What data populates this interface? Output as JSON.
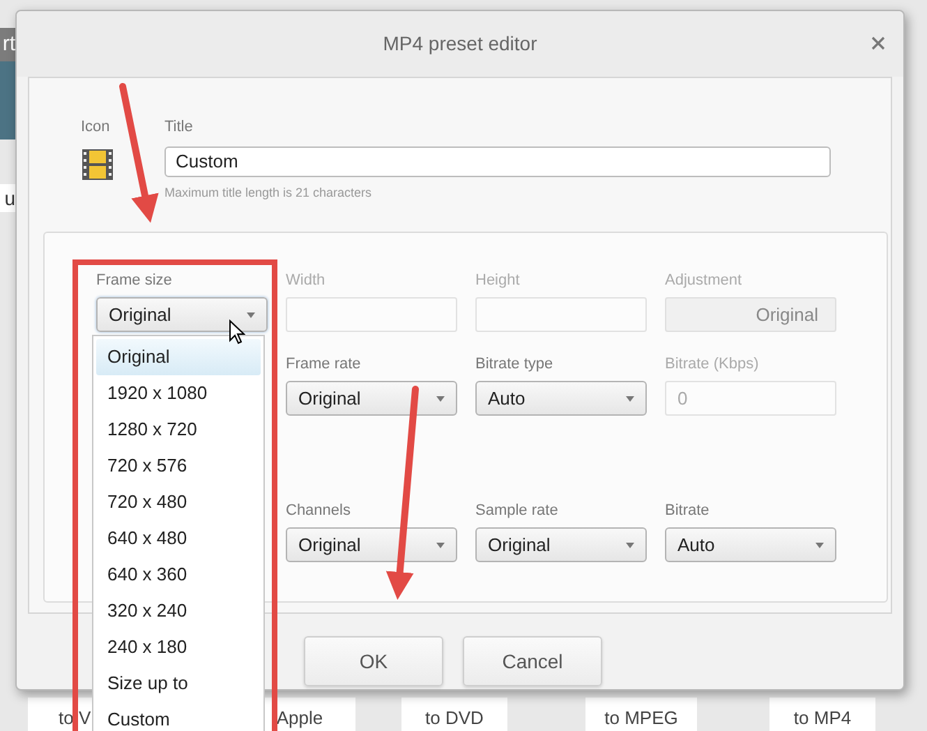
{
  "background_app": {
    "fragments": [
      "rt",
      "u"
    ],
    "bottom_tabs": [
      "to V",
      "Apple",
      "to DVD",
      "to MPEG",
      "to MP4"
    ]
  },
  "dialog": {
    "title": "MP4 preset editor",
    "icon_label": "Icon",
    "title_field": {
      "label": "Title",
      "value": "Custom",
      "hint": "Maximum title length is 21 characters"
    },
    "settings": [
      {
        "cells": [
          {
            "kind": "dropdown",
            "label": "Frame size",
            "value": "Original",
            "expanded": true
          },
          {
            "kind": "input",
            "label": "Width",
            "disabled": true
          },
          {
            "kind": "input",
            "label": "Height",
            "disabled": true
          },
          {
            "kind": "button",
            "label": "Adjustment",
            "value": "Original",
            "disabled": true
          }
        ]
      },
      {
        "cells": [
          {
            "kind": "blank"
          },
          {
            "kind": "dropdown",
            "label": "Frame rate",
            "value": "Original"
          },
          {
            "kind": "dropdown",
            "label": "Bitrate type",
            "value": "Auto"
          },
          {
            "kind": "input",
            "label": "Bitrate (Kbps)",
            "value": "0",
            "disabled": true
          }
        ]
      },
      {
        "cells": [
          {
            "kind": "blank"
          },
          {
            "kind": "dropdown",
            "label": "Channels",
            "value": "Original"
          },
          {
            "kind": "dropdown",
            "label": "Sample rate",
            "value": "Original"
          },
          {
            "kind": "dropdown",
            "label": "Bitrate",
            "value": "Auto"
          }
        ]
      }
    ],
    "frame_size_options": [
      {
        "label": "Original",
        "selected": true
      },
      {
        "label": "1920 x 1080",
        "selected": false
      },
      {
        "label": "1280 x 720",
        "selected": false
      },
      {
        "label": "720 x 576",
        "selected": false
      },
      {
        "label": "720 x 480",
        "selected": false
      },
      {
        "label": "640 x 480",
        "selected": false
      },
      {
        "label": "640 x 360",
        "selected": false
      },
      {
        "label": "320 x 240",
        "selected": false
      },
      {
        "label": "240 x 180",
        "selected": false
      },
      {
        "label": "Size up to",
        "selected": false
      },
      {
        "label": "Custom",
        "selected": false
      }
    ],
    "buttons": [
      "OK",
      "Cancel"
    ]
  }
}
